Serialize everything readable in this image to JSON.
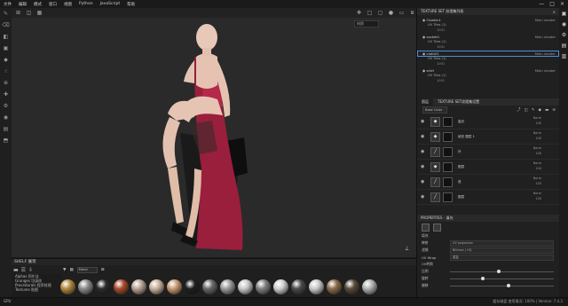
{
  "menu": [
    "文件",
    "编辑",
    "模式",
    "窗口",
    "视图",
    "Python",
    "JavaScript",
    "帮助"
  ],
  "window_controls": [
    "—",
    "□",
    "×"
  ],
  "left_tools": [
    "brush-icon",
    "eraser-icon",
    "projection-icon",
    "geometry-icon",
    "fill-icon",
    "smudge-icon",
    "clone-icon",
    "picker-icon",
    "settings-icon",
    "camera-icon",
    "color-icon",
    "bake-icon"
  ],
  "topbar_icons": [
    "grid-icon",
    "camera-icon",
    "screenshot-icon"
  ],
  "viewport": {
    "view_mode": "材质"
  },
  "shelf": {
    "title": "SHELF 展架",
    "side_items": [
      "Alphas 阿尔法",
      "Grunges 垃圾纹",
      "Procedurals 程序纹理",
      "Textures 贴图"
    ],
    "search_placeholder": "Metal",
    "spheres": [
      "#b08a3e",
      "#8a8a8a",
      "#2a2a2a",
      "#a84a2a",
      "#b8a394",
      "#c9b09a",
      "#c89a70",
      "#1f1f1f",
      "#686868",
      "#9a9a9a",
      "#c8c8c8",
      "#7f7f7f",
      "#cfcfcf",
      "#4a4a4a",
      "#c9c9c9",
      "#8d6a4a",
      "#5a4a3a",
      "#b0b0b0"
    ]
  },
  "texture_set": {
    "title": "TEXTURE SET 纹理集列表",
    "items": [
      {
        "name": "Cloakin1",
        "shader": "Main shader",
        "uv": "UV Tiles (1)",
        "tile": "1001",
        "selected": false
      },
      {
        "name": "socket1",
        "shader": "Main shader",
        "uv": "UV Tiles (1)",
        "tile": "1001",
        "selected": false
      },
      {
        "name": "cloth01",
        "shader": "Main shader",
        "uv": "UV Tiles (1)",
        "tile": "1001",
        "selected": true
      },
      {
        "name": "shirt",
        "shader": "Main shader",
        "uv": "UV Tiles (1)",
        "tile": "1001",
        "selected": false
      }
    ]
  },
  "layers_tabs": [
    "图层",
    "TEXTURE SET纹理集设置"
  ],
  "layers_channel": "Base Color",
  "layers": [
    {
      "name": "高光",
      "blend": "Norm",
      "opacity": "100",
      "icon": "fill"
    },
    {
      "name": "填充 图层 1",
      "blend": "Norm",
      "opacity": "100",
      "icon": "fill"
    },
    {
      "name": "外",
      "blend": "Norm",
      "opacity": "100",
      "icon": "paint"
    },
    {
      "name": "图层",
      "blend": "Norm",
      "opacity": "100",
      "icon": "fill"
    },
    {
      "name": "低",
      "blend": "Norm",
      "opacity": "100",
      "icon": "paint"
    },
    {
      "name": "图层",
      "blend": "Norm",
      "opacity": "100",
      "icon": "paint"
    }
  ],
  "properties": {
    "title": "PROPERTIES - 填充",
    "section": "填充",
    "rows": [
      {
        "label": "映射",
        "value": "UV projection"
      },
      {
        "label": "滤镜",
        "value": "Bilinear | HQ"
      },
      {
        "label": "UV Wrap",
        "value": "重复"
      }
    ],
    "uv_section": "UV转换",
    "sliders": [
      {
        "label": "比例",
        "fraction": 0.45
      },
      {
        "label": "旋转",
        "fraction": 0.3
      },
      {
        "label": "偏移",
        "fraction": 0.55
      }
    ]
  },
  "status": {
    "left": "GPU",
    "right": "缓存磁盘 使用情况: 100% | Version: 7.4.2"
  }
}
